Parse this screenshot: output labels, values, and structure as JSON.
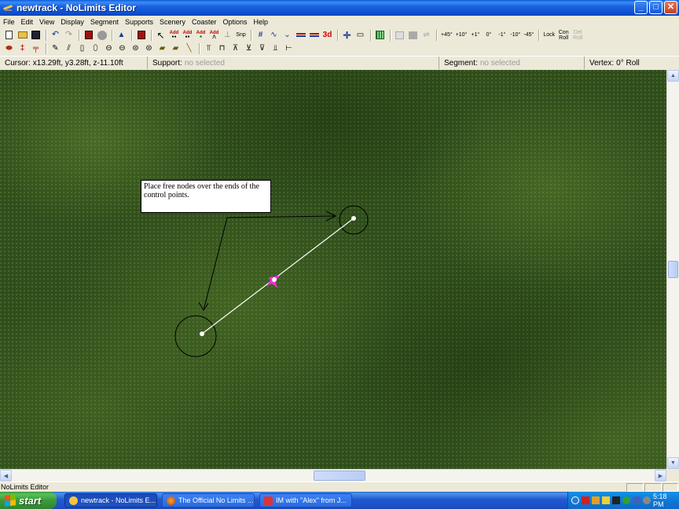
{
  "window": {
    "title": "newtrack - NoLimits Editor",
    "controls": {
      "minimize": "_",
      "maximize": "□",
      "close": "✕"
    }
  },
  "menu": [
    "File",
    "Edit",
    "View",
    "Display",
    "Segment",
    "Supports",
    "Scenery",
    "Coaster",
    "Options",
    "Help"
  ],
  "toolbar1": {
    "add_labels": [
      "Add",
      "Add",
      "Add",
      "Add"
    ],
    "snp": "Snp",
    "three_d": "3d",
    "roll_labels": [
      "+45°",
      "+10°",
      "+1°",
      "0°",
      "-1°",
      "-10°",
      "-45°"
    ],
    "lock": "Lock",
    "con_roll": "Con Roll",
    "del_roll": "Del Roll"
  },
  "infobar": {
    "cursor_label": "Cursor:",
    "cursor_value": "x13.29ft, y3.28ft, z-11.10ft",
    "support_label": "Support:",
    "support_value": "no selected",
    "segment_label": "Segment:",
    "segment_value": "no selected",
    "vertex_label": "Vertex:",
    "vertex_value": "0° Roll"
  },
  "viewport": {
    "tooltip": "Place free nodes over the ends of the control points.",
    "background": "grass"
  },
  "statusbar": {
    "text": "NoLimits Editor"
  },
  "taskbar": {
    "start_label": "start",
    "tasks": [
      {
        "label": "newtrack - NoLimits E...",
        "active": true
      },
      {
        "label": "The Official No Limits ...",
        "active": false
      },
      {
        "label": "IM with \"Alex\" from J...",
        "active": false
      }
    ],
    "clock": "5:18 PM"
  },
  "colors": {
    "titlebar": "#0a5fd8",
    "track_line": "#ffffff",
    "vertex_marker": "#ff2bd8",
    "taskbar": "#2358d0",
    "start": "#3a9a3a"
  }
}
